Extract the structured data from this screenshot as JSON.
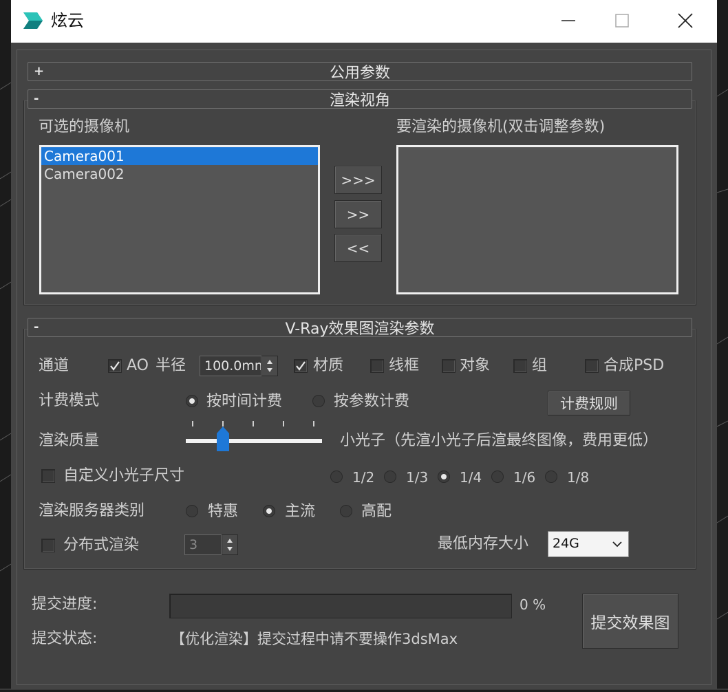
{
  "window": {
    "title": "炫云",
    "controls": [
      "minimize-icon",
      "maximize-icon",
      "close-icon"
    ]
  },
  "rollouts": {
    "common": {
      "sign": "+",
      "title": "公用参数"
    },
    "view": {
      "sign": "-",
      "title": "渲染视角"
    },
    "vray": {
      "sign": "-",
      "title": "V-Ray效果图渲染参数"
    }
  },
  "cameras": {
    "available_label": "可选的摄像机",
    "available": [
      {
        "name": "Camera001",
        "selected": true
      },
      {
        "name": "Camera002",
        "selected": false
      }
    ],
    "render_label": "要渲染的摄像机(双击调整参数)",
    "render": [],
    "buttons": {
      "add_all": ">>>",
      "add": ">>",
      "remove": "<<"
    }
  },
  "vray": {
    "channel": {
      "label": "通道",
      "ao": {
        "label": "AO",
        "checked": true
      },
      "radius_label": "半径",
      "radius_value": "100.0mm",
      "material": {
        "label": "材质",
        "checked": true
      },
      "wireframe": {
        "label": "线框",
        "checked": false
      },
      "object": {
        "label": "对象",
        "checked": false
      },
      "group": {
        "label": "组",
        "checked": false
      },
      "psd": {
        "label": "合成PSD",
        "checked": false
      }
    },
    "billing": {
      "label": "计费模式",
      "by_time": {
        "label": "按时间计费",
        "selected": true
      },
      "by_param": {
        "label": "按参数计费",
        "selected": false
      },
      "rules_button": "计费规则"
    },
    "quality": {
      "label": "渲染质量",
      "level": 0.25,
      "description": "小光子（先渲小光子后渲最终图像，费用更低）"
    },
    "custom_photon": {
      "label": "自定义小光子尺寸",
      "checked": false,
      "options": [
        {
          "label": "1/2",
          "selected": false
        },
        {
          "label": "1/3",
          "selected": false
        },
        {
          "label": "1/4",
          "selected": true
        },
        {
          "label": "1/6",
          "selected": false
        },
        {
          "label": "1/8",
          "selected": false
        }
      ]
    },
    "server": {
      "label": "渲染服务器类别",
      "options": [
        {
          "label": "特惠",
          "selected": false
        },
        {
          "label": "主流",
          "selected": true
        },
        {
          "label": "高配",
          "selected": false
        }
      ]
    },
    "distributed": {
      "label": "分布式渲染",
      "checked": false,
      "value": "3"
    },
    "memory": {
      "label": "最低内存大小",
      "value": "24G"
    }
  },
  "submit": {
    "progress_label": "提交进度:",
    "progress_percent": 0,
    "progress_text": "0 %",
    "status_label": "提交状态:",
    "status_text": "【优化渲染】提交过程中请不要操作3dsMax",
    "button": "提交效果图"
  },
  "colors": {
    "selection": "#1e78d7",
    "panel": "#444444",
    "titlebar": "#ffffff"
  }
}
